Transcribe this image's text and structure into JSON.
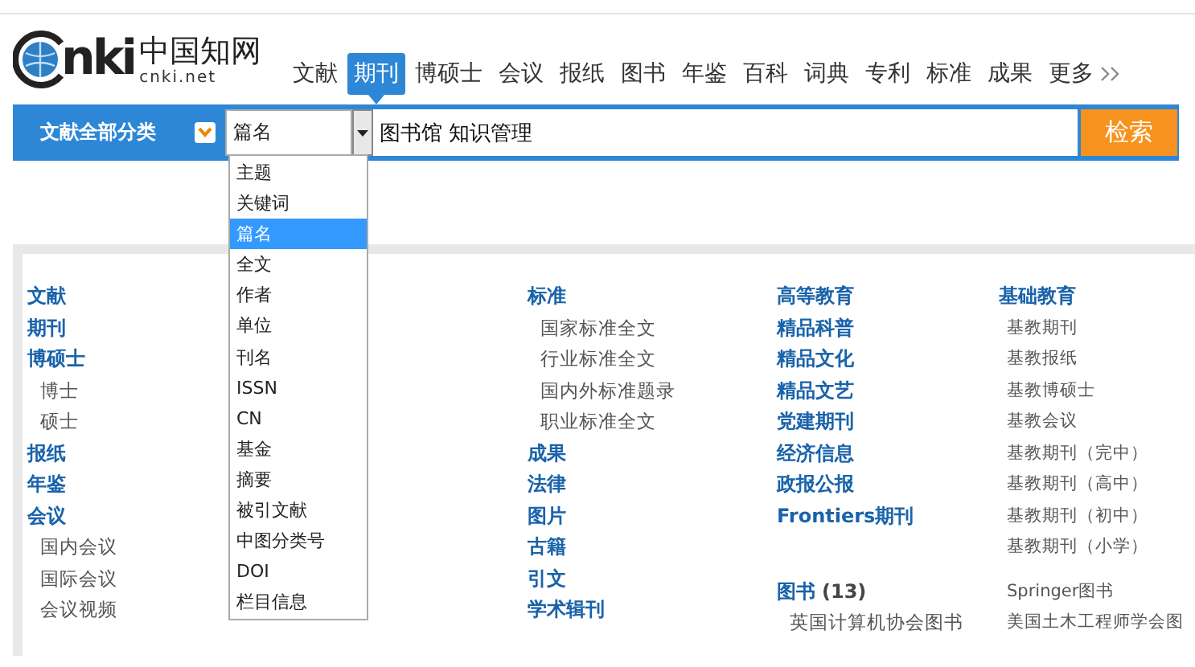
{
  "logo": {
    "mark": "nki",
    "name": "中国知网",
    "domain": "cnki.net"
  },
  "nav": [
    {
      "label": "文献",
      "selected": false
    },
    {
      "label": "期刊",
      "selected": true
    },
    {
      "label": "博硕士",
      "selected": false
    },
    {
      "label": "会议",
      "selected": false
    },
    {
      "label": "报纸",
      "selected": false
    },
    {
      "label": "图书",
      "selected": false
    },
    {
      "label": "年鉴",
      "selected": false
    },
    {
      "label": "百科",
      "selected": false
    },
    {
      "label": "词典",
      "selected": false
    },
    {
      "label": "专利",
      "selected": false
    },
    {
      "label": "标准",
      "selected": false
    },
    {
      "label": "成果",
      "selected": false
    },
    {
      "label": "更多",
      "selected": false,
      "more": true
    }
  ],
  "search": {
    "category": "文献全部分类",
    "field": "篇名",
    "value": "图书馆 知识管理",
    "button": "检索"
  },
  "field_menu": [
    {
      "label": "主题",
      "selected": false
    },
    {
      "label": "关键词",
      "selected": false
    },
    {
      "label": "篇名",
      "selected": true
    },
    {
      "label": "全文",
      "selected": false
    },
    {
      "label": "作者",
      "selected": false
    },
    {
      "label": "单位",
      "selected": false
    },
    {
      "label": "刊名",
      "selected": false
    },
    {
      "label": "ISSN",
      "selected": false
    },
    {
      "label": "CN",
      "selected": false
    },
    {
      "label": "基金",
      "selected": false
    },
    {
      "label": "摘要",
      "selected": false
    },
    {
      "label": "被引文献",
      "selected": false
    },
    {
      "label": "中图分类号",
      "selected": false
    },
    {
      "label": "DOI",
      "selected": false
    },
    {
      "label": "栏目信息",
      "selected": false
    }
  ],
  "columns": [
    {
      "blocks": [
        [
          {
            "kind": "main",
            "label": "文献"
          },
          {
            "kind": "main",
            "label": "期刊"
          },
          {
            "kind": "main",
            "label": "博硕士"
          },
          {
            "kind": "sub",
            "label": "博士"
          },
          {
            "kind": "sub",
            "label": "硕士"
          },
          {
            "kind": "main",
            "label": "报纸"
          },
          {
            "kind": "main",
            "label": "年鉴"
          },
          {
            "kind": "main",
            "label": "会议"
          },
          {
            "kind": "sub",
            "label": "国内会议"
          },
          {
            "kind": "sub",
            "label": "国际会议"
          },
          {
            "kind": "sub",
            "label": "会议视频"
          }
        ]
      ]
    },
    {
      "blocks": [
        [
          {
            "kind": "main",
            "label": "标准"
          },
          {
            "kind": "sub",
            "label": "国家标准全文"
          },
          {
            "kind": "sub",
            "label": "行业标准全文"
          },
          {
            "kind": "sub",
            "label": "国内外标准题录"
          },
          {
            "kind": "sub",
            "label": "职业标准全文"
          },
          {
            "kind": "main",
            "label": "成果"
          },
          {
            "kind": "main",
            "label": "法律"
          },
          {
            "kind": "main",
            "label": "图片"
          },
          {
            "kind": "main",
            "label": "古籍"
          },
          {
            "kind": "main",
            "label": "引文"
          },
          {
            "kind": "main",
            "label": "学术辑刊"
          }
        ]
      ]
    },
    {
      "blocks": [
        [
          {
            "kind": "main",
            "label": "高等教育"
          },
          {
            "kind": "main",
            "label": "精品科普"
          },
          {
            "kind": "main",
            "label": "精品文化"
          },
          {
            "kind": "main",
            "label": "精品文艺"
          },
          {
            "kind": "main",
            "label": "党建期刊"
          },
          {
            "kind": "main",
            "label": "经济信息"
          },
          {
            "kind": "main",
            "label": "政报公报"
          },
          {
            "kind": "main",
            "label": "Frontiers期刊"
          }
        ],
        [
          {
            "kind": "main",
            "label": "图书",
            "count": "(13)"
          },
          {
            "kind": "sub",
            "label": "英国计算机协会图书"
          }
        ]
      ]
    },
    {
      "blocks": [
        [
          {
            "kind": "main",
            "label": "基础教育"
          },
          {
            "kind": "sub",
            "label": "基教期刊"
          },
          {
            "kind": "sub",
            "label": "基教报纸"
          },
          {
            "kind": "sub",
            "label": "基教博硕士"
          },
          {
            "kind": "sub",
            "label": "基教会议"
          },
          {
            "kind": "sub",
            "label": "基教期刊（完中）"
          },
          {
            "kind": "sub",
            "label": "基教期刊（高中）"
          },
          {
            "kind": "sub",
            "label": "基教期刊（初中）"
          },
          {
            "kind": "sub",
            "label": "基教期刊（小学）"
          }
        ],
        [
          {
            "kind": "plain",
            "label": "Springer图书"
          },
          {
            "kind": "sub",
            "label": "美国土木工程师学会图"
          }
        ]
      ]
    }
  ]
}
